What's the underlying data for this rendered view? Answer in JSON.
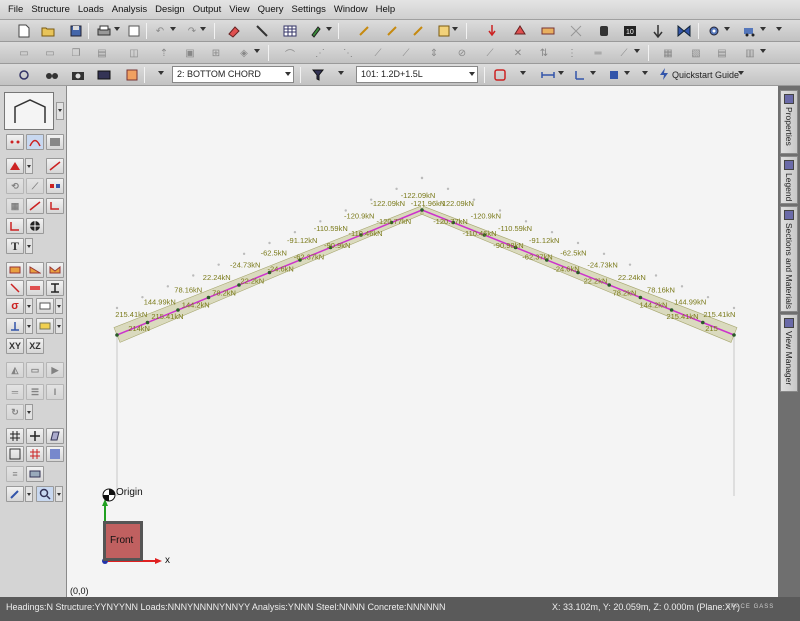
{
  "menu": {
    "items": [
      "File",
      "Structure",
      "Loads",
      "Analysis",
      "Design",
      "Output",
      "View",
      "Query",
      "Settings",
      "Window",
      "Help"
    ]
  },
  "toolbar3": {
    "group_select": "2: BOTTOM CHORD",
    "load_case_select": "101: 1.2D+1.5L",
    "quickstart_label": "Quickstart Guide"
  },
  "viewport": {
    "coordinate_readout": "(0,0)",
    "origin_label": "Origin",
    "view_cube_label": "Front",
    "x_axis_label": "x"
  },
  "side_tabs": [
    "Properties",
    "Legend",
    "Sections and Materials",
    "View Manager"
  ],
  "status": {
    "left": "Headings:N Structure:YYNYYNN Loads:NNNYNNNNYNNYY Analysis:YNNN Steel:NNNN Concrete:NNNNNN",
    "right": "X: 33.102m, Y: 20.059m, Z: 0.000m (Plane:XY)",
    "logo": "SPACE GASS"
  },
  "force_labels": {
    "left_upper": [
      "215.41kN",
      "144.99kN",
      "78.16kN",
      "22.24kN",
      "-24.73kN",
      "-62.5kN",
      "-91.12kN",
      "-110.59kN",
      "-120.9kN",
      "-122.09kN"
    ],
    "left_lower": [
      "214kN",
      "215.41kN",
      "144.2kN",
      "78.2kN",
      "22.2kN",
      "-24.6kN",
      "-62.37kN",
      "-90.9kN",
      "-110.46kN",
      "-120.77kN"
    ],
    "apex": [
      "-122.09kN",
      "-121.96kN"
    ],
    "right_upper": [
      "-122.09kN",
      "-120.9kN",
      "-110.59kN",
      "-91.12kN",
      "-62.5kN",
      "-24.73kN",
      "22.24kN",
      "78.16kN",
      "144.99kN",
      "215.41kN"
    ],
    "right_lower": [
      "-120.77kN",
      "-110.46kN",
      "-90.98kN",
      "-62.37kN",
      "-24.6kN",
      "22.2kN",
      "78.2kN",
      "144.2kN",
      "215.41kN",
      "215"
    ]
  },
  "colors": {
    "member": "#cc33cc",
    "force_fill": "#c8c89a",
    "force_text": "#7a7a1a",
    "node": "#2a5a2a",
    "view_cube": "#c06060",
    "x_axis": "#e02020",
    "y_axis": "#20a020"
  }
}
